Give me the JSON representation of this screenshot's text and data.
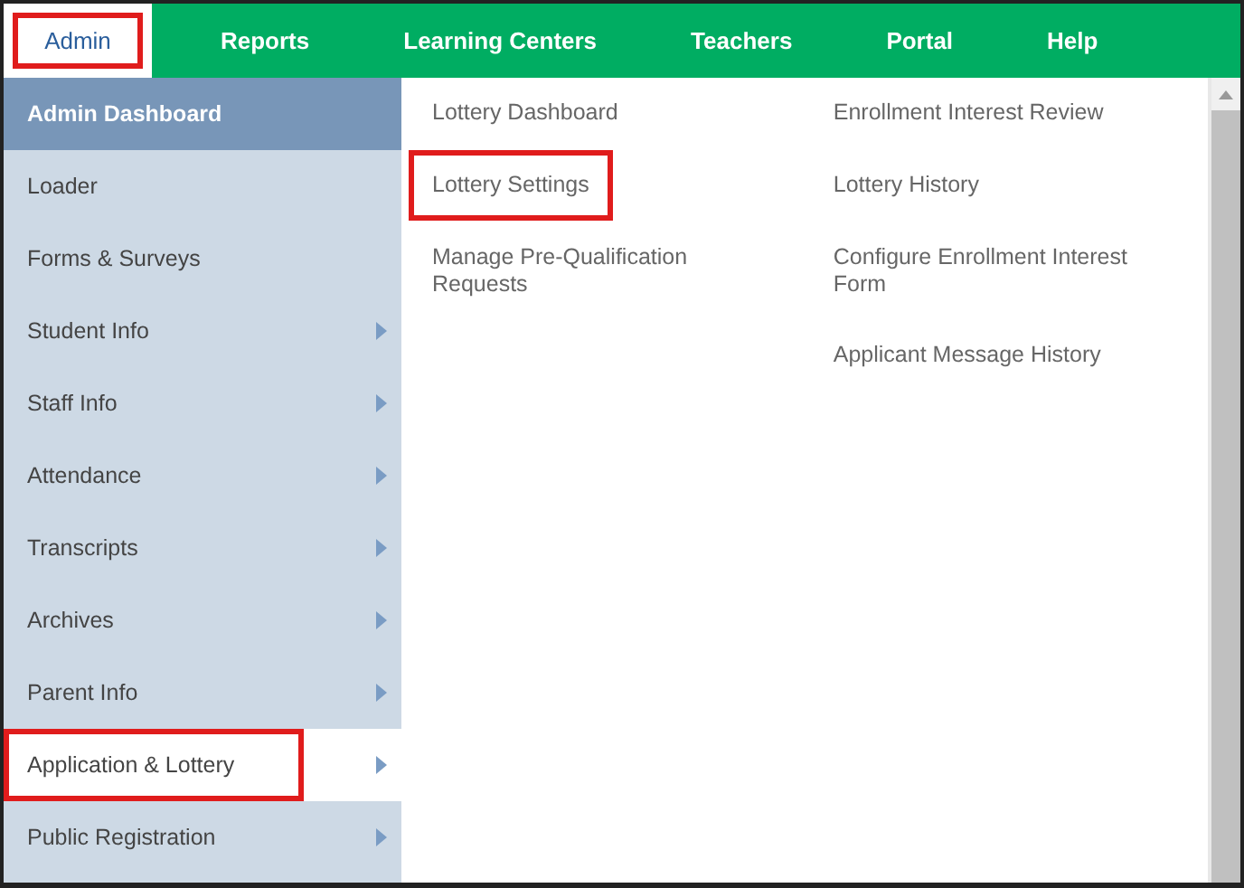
{
  "nav": [
    {
      "label": "Admin",
      "selected": true,
      "highlighted": true
    },
    {
      "label": "Reports",
      "selected": false,
      "highlighted": false
    },
    {
      "label": "Learning Centers",
      "selected": false,
      "highlighted": false
    },
    {
      "label": "Teachers",
      "selected": false,
      "highlighted": false
    },
    {
      "label": "Portal",
      "selected": false,
      "highlighted": false
    },
    {
      "label": "Help",
      "selected": false,
      "highlighted": false
    }
  ],
  "sidebar": {
    "items": [
      {
        "label": "Admin Dashboard",
        "kind": "header",
        "has_submenu": false,
        "selected": false,
        "highlighted": false
      },
      {
        "label": "Loader",
        "kind": "item",
        "has_submenu": false,
        "selected": false,
        "highlighted": false
      },
      {
        "label": "Forms & Surveys",
        "kind": "item",
        "has_submenu": false,
        "selected": false,
        "highlighted": false
      },
      {
        "label": "Student Info",
        "kind": "item",
        "has_submenu": true,
        "selected": false,
        "highlighted": false
      },
      {
        "label": "Staff Info",
        "kind": "item",
        "has_submenu": true,
        "selected": false,
        "highlighted": false
      },
      {
        "label": "Attendance",
        "kind": "item",
        "has_submenu": true,
        "selected": false,
        "highlighted": false
      },
      {
        "label": "Transcripts",
        "kind": "item",
        "has_submenu": true,
        "selected": false,
        "highlighted": false
      },
      {
        "label": "Archives",
        "kind": "item",
        "has_submenu": true,
        "selected": false,
        "highlighted": false
      },
      {
        "label": "Parent Info",
        "kind": "item",
        "has_submenu": true,
        "selected": false,
        "highlighted": false
      },
      {
        "label": "Application & Lottery",
        "kind": "item",
        "has_submenu": true,
        "selected": true,
        "highlighted": true
      },
      {
        "label": "Public Registration",
        "kind": "item",
        "has_submenu": true,
        "selected": false,
        "highlighted": false
      }
    ]
  },
  "submenu": {
    "columns": [
      [
        {
          "label": "Lottery Dashboard",
          "highlighted": false
        },
        {
          "label": "Lottery Settings",
          "highlighted": true
        },
        {
          "label": "Manage Pre-Qualification Requests",
          "highlighted": false
        }
      ],
      [
        {
          "label": "Enrollment Interest Review",
          "highlighted": false
        },
        {
          "label": "Lottery History",
          "highlighted": false
        },
        {
          "label": "Configure Enrollment Interest Form",
          "highlighted": false
        },
        {
          "label": "Applicant Message History",
          "highlighted": false
        }
      ]
    ]
  }
}
